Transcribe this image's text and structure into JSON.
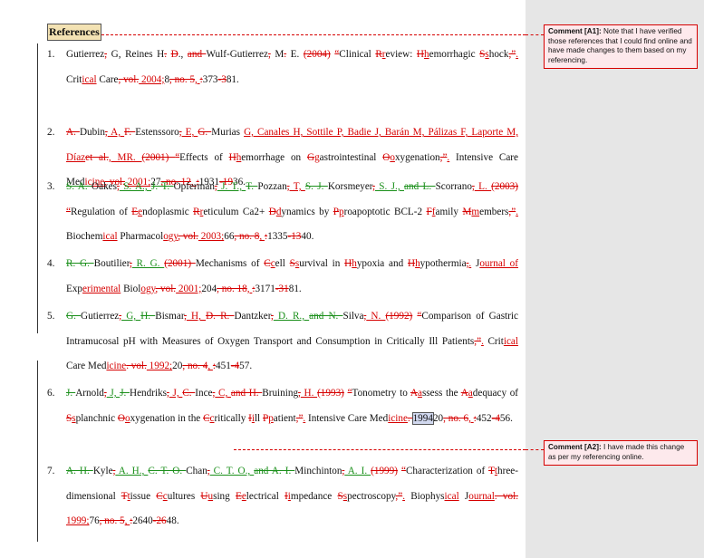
{
  "heading": "References",
  "comments": [
    {
      "label": "Comment [A1]:",
      "text": "Note that I have verified those references that I could find online and have made changes to them based on my referencing."
    },
    {
      "label": "Comment [A2]:",
      "text": "I have made this change as per my referencing online."
    }
  ],
  "references": [
    {
      "num": "1.",
      "segments": [
        [
          "n",
          "Gutierrez"
        ],
        [
          "d",
          ","
        ],
        [
          "n",
          " G, Reines H"
        ],
        [
          "d",
          "."
        ],
        [
          "n",
          " "
        ],
        [
          "d",
          "D"
        ],
        [
          "n",
          "., "
        ],
        [
          "d",
          "and "
        ],
        [
          "n",
          "Wulf-Gutierrez"
        ],
        [
          "d",
          ","
        ],
        [
          "n",
          " M"
        ],
        [
          "d",
          "."
        ],
        [
          "n",
          " E. "
        ],
        [
          "d",
          "(2004)"
        ],
        [
          "n",
          " "
        ],
        [
          "d",
          "“"
        ],
        [
          "n",
          "Clinical "
        ],
        [
          "d",
          "R"
        ],
        [
          "i",
          "r"
        ],
        [
          "n",
          "eview: "
        ],
        [
          "d",
          "H"
        ],
        [
          "i",
          "h"
        ],
        [
          "n",
          "emorrhagic "
        ],
        [
          "d",
          "S"
        ],
        [
          "i",
          "s"
        ],
        [
          "n",
          "hock"
        ],
        [
          "d",
          ",”"
        ],
        [
          "i",
          "."
        ],
        [
          "n",
          " Crit"
        ],
        [
          "i",
          "ical"
        ],
        [
          "n",
          " Care"
        ],
        [
          "d",
          ", vol."
        ],
        [
          "i",
          " 2004;"
        ],
        [
          "n",
          "8"
        ],
        [
          "d",
          ", no. 5"
        ],
        [
          "i",
          ", "
        ],
        [
          "d",
          ":"
        ],
        [
          "n",
          "373"
        ],
        [
          "d",
          "-3"
        ],
        [
          "n",
          "81."
        ]
      ]
    },
    {
      "num": "2.",
      "segments": [
        [
          "d",
          "A. "
        ],
        [
          "n",
          "Dubin"
        ],
        [
          "d",
          ","
        ],
        [
          "i",
          " A, "
        ],
        [
          "d",
          "F. "
        ],
        [
          "n",
          "Estenssoro"
        ],
        [
          "d",
          ","
        ],
        [
          "i",
          " E, "
        ],
        [
          "d",
          "G. "
        ],
        [
          "n",
          "Murias "
        ],
        [
          "i",
          "G, Canales H, Sottile P, Badie J, Barán M, Pálizas F, Laporte M, Díaz"
        ],
        [
          "d",
          "et al."
        ],
        [
          "i",
          ", MR. "
        ],
        [
          "d",
          "(2001) "
        ],
        [
          "d",
          "“"
        ],
        [
          "n",
          "Effects of "
        ],
        [
          "d",
          "H"
        ],
        [
          "i",
          "h"
        ],
        [
          "n",
          "emorrhage on "
        ],
        [
          "d",
          "G"
        ],
        [
          "i",
          "g"
        ],
        [
          "n",
          "astrointestinal "
        ],
        [
          "d",
          "O"
        ],
        [
          "i",
          "o"
        ],
        [
          "n",
          "xygenation"
        ],
        [
          "d",
          ",”"
        ],
        [
          "i",
          "."
        ],
        [
          "n",
          " Intensive Care Med"
        ],
        [
          "i",
          "icine"
        ],
        [
          "d",
          ", vol."
        ],
        [
          "i",
          " 2001;"
        ],
        [
          "n",
          "27"
        ],
        [
          "d",
          ", no. 12"
        ],
        [
          "i",
          ", "
        ],
        [
          "d",
          ":"
        ],
        [
          "n",
          "1931"
        ],
        [
          "d",
          "-19"
        ],
        [
          "n",
          "36."
        ]
      ]
    },
    {
      "num": "3.",
      "segments": [
        [
          "D",
          "S. A. "
        ],
        [
          "n",
          "Oakes"
        ],
        [
          "d",
          ","
        ],
        [
          "g",
          " S. A., "
        ],
        [
          "D",
          "J. T. "
        ],
        [
          "n",
          "Opferman"
        ],
        [
          "d",
          ","
        ],
        [
          "g",
          " J. T., "
        ],
        [
          "D",
          "T. "
        ],
        [
          "n",
          "Pozzan"
        ],
        [
          "d",
          ","
        ],
        [
          "i",
          " T, "
        ],
        [
          "D",
          "S. J. "
        ],
        [
          "n",
          "Korsmeyer"
        ],
        [
          "d",
          ","
        ],
        [
          "g",
          " S. J., "
        ],
        [
          "D",
          "and L. "
        ],
        [
          "n",
          "Scorrano"
        ],
        [
          "d",
          ","
        ],
        [
          "i",
          " L. "
        ],
        [
          "d",
          "(2003)"
        ],
        [
          "n",
          " "
        ],
        [
          "d",
          "“"
        ],
        [
          "n",
          "Regulation of "
        ],
        [
          "d",
          "E"
        ],
        [
          "i",
          "e"
        ],
        [
          "n",
          "ndoplasmic "
        ],
        [
          "d",
          "R"
        ],
        [
          "i",
          "r"
        ],
        [
          "n",
          "eticulum Ca2+ "
        ],
        [
          "d",
          "D"
        ],
        [
          "i",
          "d"
        ],
        [
          "n",
          "ynamics by "
        ],
        [
          "d",
          "P"
        ],
        [
          "i",
          "p"
        ],
        [
          "n",
          "roapoptotic BCL-2 "
        ],
        [
          "d",
          "F"
        ],
        [
          "i",
          "f"
        ],
        [
          "n",
          "amily "
        ],
        [
          "d",
          "M"
        ],
        [
          "i",
          "m"
        ],
        [
          "n",
          "embers"
        ],
        [
          "d",
          ",”"
        ],
        [
          "i",
          "."
        ],
        [
          "n",
          " Biochem"
        ],
        [
          "i",
          "ical"
        ],
        [
          "n",
          " Pharmacol"
        ],
        [
          "i",
          "ogy"
        ],
        [
          "d",
          ", vol."
        ],
        [
          "i",
          " 2003;"
        ],
        [
          "n",
          "66"
        ],
        [
          "d",
          ", no. 8"
        ],
        [
          "i",
          ", "
        ],
        [
          "d",
          ":"
        ],
        [
          "n",
          "1335"
        ],
        [
          "d",
          "-13"
        ],
        [
          "n",
          "40."
        ]
      ]
    },
    {
      "num": "4.",
      "segments": [
        [
          "D",
          "R. G. "
        ],
        [
          "n",
          "Boutilier"
        ],
        [
          "d",
          ","
        ],
        [
          "g",
          " R. G. "
        ],
        [
          "d",
          "(2001) "
        ],
        [
          "n",
          "Mechanisms of "
        ],
        [
          "d",
          "C"
        ],
        [
          "i",
          "c"
        ],
        [
          "n",
          "ell "
        ],
        [
          "d",
          "S"
        ],
        [
          "i",
          "s"
        ],
        [
          "n",
          "urvival in "
        ],
        [
          "d",
          "H"
        ],
        [
          "i",
          "h"
        ],
        [
          "n",
          "ypoxia and "
        ],
        [
          "d",
          "H"
        ],
        [
          "i",
          "h"
        ],
        [
          "n",
          "ypothermia"
        ],
        [
          "d",
          ","
        ],
        [
          "i",
          "."
        ],
        [
          "n",
          " J"
        ],
        [
          "i",
          "ournal of"
        ],
        [
          "n",
          " Exp"
        ],
        [
          "i",
          "erimental"
        ],
        [
          "n",
          " Biol"
        ],
        [
          "i",
          "ogy"
        ],
        [
          "d",
          ", vol."
        ],
        [
          "i",
          " 2001;"
        ],
        [
          "n",
          "204"
        ],
        [
          "d",
          ", no. 18"
        ],
        [
          "i",
          ", "
        ],
        [
          "d",
          ":"
        ],
        [
          "n",
          "3171"
        ],
        [
          "d",
          "-31"
        ],
        [
          "n",
          "81."
        ]
      ]
    },
    {
      "num": "5.",
      "segments": [
        [
          "D",
          "G. "
        ],
        [
          "n",
          "Gutierrez"
        ],
        [
          "d",
          ","
        ],
        [
          "g",
          " G, "
        ],
        [
          "D",
          "H. "
        ],
        [
          "n",
          "Bismar"
        ],
        [
          "d",
          ","
        ],
        [
          "i",
          " H, "
        ],
        [
          "d",
          "D. R. "
        ],
        [
          "n",
          "Dantzker"
        ],
        [
          "d",
          ","
        ],
        [
          "g",
          " D. R., "
        ],
        [
          "D",
          "and N. "
        ],
        [
          "n",
          "Silva"
        ],
        [
          "d",
          ","
        ],
        [
          "i",
          " N. "
        ],
        [
          "d",
          "(1992)"
        ],
        [
          "n",
          " "
        ],
        [
          "d",
          "“"
        ],
        [
          "n",
          "Comparison of Gastric Intramucosal pH with Measures of Oxygen Transport and Consumption in Critically Ill Patients"
        ],
        [
          "d",
          ",”"
        ],
        [
          "i",
          "."
        ],
        [
          "n",
          " Crit"
        ],
        [
          "i",
          "ical"
        ],
        [
          "n",
          " Care Med"
        ],
        [
          "i",
          "icine"
        ],
        [
          "d",
          ". vol."
        ],
        [
          "i",
          " 1992;"
        ],
        [
          "n",
          "20"
        ],
        [
          "d",
          ", no. 4"
        ],
        [
          "i",
          ", "
        ],
        [
          "d",
          ":"
        ],
        [
          "n",
          "451"
        ],
        [
          "d",
          "-4"
        ],
        [
          "n",
          "57."
        ]
      ]
    },
    {
      "num": "6.",
      "segments": [
        [
          "D",
          "J. "
        ],
        [
          "n",
          "Arnold"
        ],
        [
          "d",
          ","
        ],
        [
          "g",
          " J, "
        ],
        [
          "D",
          "J. "
        ],
        [
          "n",
          "Hendriks"
        ],
        [
          "d",
          ","
        ],
        [
          "i",
          " J, "
        ],
        [
          "d",
          "C. "
        ],
        [
          "n",
          "Ince"
        ],
        [
          "d",
          ","
        ],
        [
          "i",
          " C, "
        ],
        [
          "d",
          "and H. "
        ],
        [
          "n",
          "Bruining"
        ],
        [
          "d",
          ","
        ],
        [
          "i",
          " H. "
        ],
        [
          "d",
          "(1993)"
        ],
        [
          "n",
          " "
        ],
        [
          "d",
          "“"
        ],
        [
          "n",
          "Tonometry to "
        ],
        [
          "d",
          "A"
        ],
        [
          "i",
          "a"
        ],
        [
          "n",
          "ssess the "
        ],
        [
          "d",
          "A"
        ],
        [
          "i",
          "a"
        ],
        [
          "n",
          "dequacy of "
        ],
        [
          "d",
          "S"
        ],
        [
          "i",
          "s"
        ],
        [
          "n",
          "planchnic "
        ],
        [
          "d",
          "O"
        ],
        [
          "i",
          "o"
        ],
        [
          "n",
          "xygenation in the "
        ],
        [
          "d",
          "C"
        ],
        [
          "i",
          "c"
        ],
        [
          "n",
          "ritically "
        ],
        [
          "d",
          "I"
        ],
        [
          "i",
          "i"
        ],
        [
          "n",
          "ll "
        ],
        [
          "d",
          "P"
        ],
        [
          "i",
          "p"
        ],
        [
          "n",
          "atient"
        ],
        [
          "d",
          ",”"
        ],
        [
          "i",
          "."
        ],
        [
          "n",
          " Intensive Care Med"
        ],
        [
          "i",
          "icine"
        ],
        [
          "d",
          ". "
        ],
        [
          "h",
          "1994"
        ],
        [
          "n",
          "20"
        ],
        [
          "d",
          ", no. 6"
        ],
        [
          "i",
          ", "
        ],
        [
          "d",
          ":"
        ],
        [
          "n",
          "452"
        ],
        [
          "d",
          "-4"
        ],
        [
          "n",
          "56."
        ]
      ]
    },
    {
      "num": "7.",
      "segments": [
        [
          "D",
          "A. H. "
        ],
        [
          "n",
          "Kyle"
        ],
        [
          "d",
          ","
        ],
        [
          "g",
          " A. H., "
        ],
        [
          "D",
          "C. T. O. "
        ],
        [
          "n",
          "Chan"
        ],
        [
          "d",
          ","
        ],
        [
          "g",
          " C. T. O., "
        ],
        [
          "D",
          "and A. I. "
        ],
        [
          "n",
          "Minchinton"
        ],
        [
          "d",
          ","
        ],
        [
          "g",
          " A. I. "
        ],
        [
          "d",
          "(1999)"
        ],
        [
          "n",
          " "
        ],
        [
          "d",
          "“"
        ],
        [
          "n",
          "Characterization of "
        ],
        [
          "d",
          "T"
        ],
        [
          "i",
          "t"
        ],
        [
          "n",
          "hree-dimensional "
        ],
        [
          "d",
          "T"
        ],
        [
          "i",
          "t"
        ],
        [
          "n",
          "issue "
        ],
        [
          "d",
          "C"
        ],
        [
          "i",
          "c"
        ],
        [
          "n",
          "ultures "
        ],
        [
          "d",
          "U"
        ],
        [
          "i",
          "u"
        ],
        [
          "n",
          "sing "
        ],
        [
          "d",
          "E"
        ],
        [
          "i",
          "e"
        ],
        [
          "n",
          "lectrical "
        ],
        [
          "d",
          "I"
        ],
        [
          "i",
          "i"
        ],
        [
          "n",
          "mpedance "
        ],
        [
          "d",
          "S"
        ],
        [
          "i",
          "s"
        ],
        [
          "n",
          "pectroscopy"
        ],
        [
          "d",
          ",”"
        ],
        [
          "i",
          "."
        ],
        [
          "n",
          " Biophys"
        ],
        [
          "i",
          "ical"
        ],
        [
          "n",
          " J"
        ],
        [
          "i",
          "ournal"
        ],
        [
          "d",
          ". vol."
        ],
        [
          "i",
          " 1999;"
        ],
        [
          "n",
          "76"
        ],
        [
          "d",
          ", no. 5"
        ],
        [
          "i",
          ", "
        ],
        [
          "d",
          ":"
        ],
        [
          "n",
          "2640"
        ],
        [
          "d",
          "-26"
        ],
        [
          "n",
          "48."
        ]
      ]
    }
  ]
}
